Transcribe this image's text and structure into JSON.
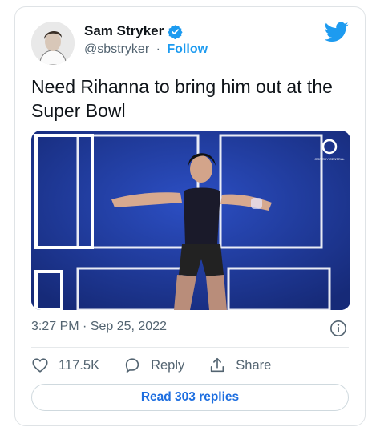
{
  "author": {
    "name": "Sam Stryker",
    "handle": "@sbstryker",
    "separator": "·",
    "follow_label": "Follow"
  },
  "tweet": {
    "text": "Need Rihanna to bring him out at the Super Bowl",
    "timestamp": "3:27 PM · Sep 25, 2022"
  },
  "actions": {
    "likes": "117.5K",
    "reply_label": "Reply",
    "share_label": "Share",
    "read_replies_label": "Read 303 replies"
  },
  "media": {
    "logo_text": "COMEDY CENTRAL"
  },
  "colors": {
    "twitter_blue": "#1d9bf0",
    "link_blue": "#1d6ee0",
    "muted": "#536471",
    "stage_blue": "#1e3a9a"
  },
  "icons": {
    "twitter_logo": "twitter-bird-icon",
    "verified": "verified-badge-icon",
    "info": "info-icon",
    "like": "heart-icon",
    "reply": "speech-bubble-icon",
    "share": "share-icon"
  }
}
